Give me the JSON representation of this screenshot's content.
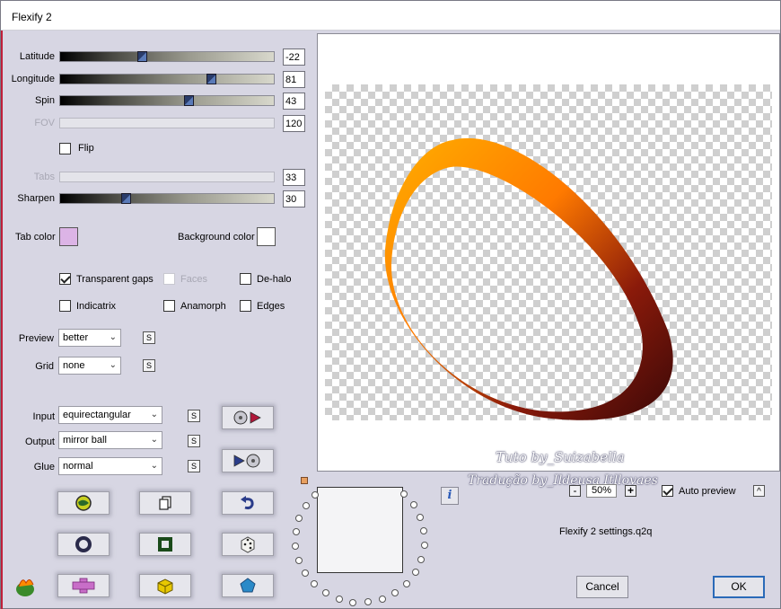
{
  "window": {
    "title": "Flexify 2"
  },
  "sliders": [
    {
      "label": "Latitude",
      "value": "-22",
      "fraction": 0.38,
      "enabled": true
    },
    {
      "label": "Longitude",
      "value": "81",
      "fraction": 0.72,
      "enabled": true
    },
    {
      "label": "Spin",
      "value": "43",
      "fraction": 0.61,
      "enabled": true
    },
    {
      "label": "FOV",
      "value": "120",
      "enabled": false
    },
    {
      "label": "Tabs",
      "value": "33",
      "enabled": false
    },
    {
      "label": "Sharpen",
      "value": "30",
      "fraction": 0.3,
      "enabled": true
    }
  ],
  "flip": {
    "label": "Flip",
    "checked": false
  },
  "colors": {
    "tab_label": "Tab color",
    "tab_color": "#dcb4e6",
    "background_label": "Background color",
    "background_color": "#ffffff"
  },
  "options": {
    "transparent_gaps": {
      "label": "Transparent gaps",
      "checked": true
    },
    "faces": {
      "label": "Faces",
      "checked": false,
      "enabled": false
    },
    "de_halo": {
      "label": "De-halo",
      "checked": false
    },
    "indicatrix": {
      "label": "Indicatrix",
      "checked": false
    },
    "anamorph": {
      "label": "Anamorph",
      "checked": false
    },
    "edges": {
      "label": "Edges",
      "checked": false
    }
  },
  "dropdowns": {
    "preview": {
      "label": "Preview",
      "value": "better"
    },
    "grid": {
      "label": "Grid",
      "value": "none"
    },
    "input": {
      "label": "Input",
      "value": "equirectangular"
    },
    "output": {
      "label": "Output",
      "value": "mirror ball"
    },
    "glue": {
      "label": "Glue",
      "value": "normal"
    },
    "s_label": "S"
  },
  "zoom": {
    "value": "50%",
    "minus": "-",
    "plus": "+"
  },
  "auto_preview": {
    "label": "Auto preview",
    "checked": true,
    "button": "^"
  },
  "info_icon": "i",
  "settings_file": "Flexify 2 settings.q2q",
  "watermark": {
    "line1": "Tuto by_Suizabella",
    "line2": "Tradução by_Ildeusa Itllovaes"
  },
  "buttons": {
    "cancel": "Cancel",
    "ok": "OK"
  },
  "accent_colors": {
    "ring_orange": "#ff8a00",
    "ring_dark": "#3a0a0a",
    "tab_color": "#dcb4e6"
  }
}
